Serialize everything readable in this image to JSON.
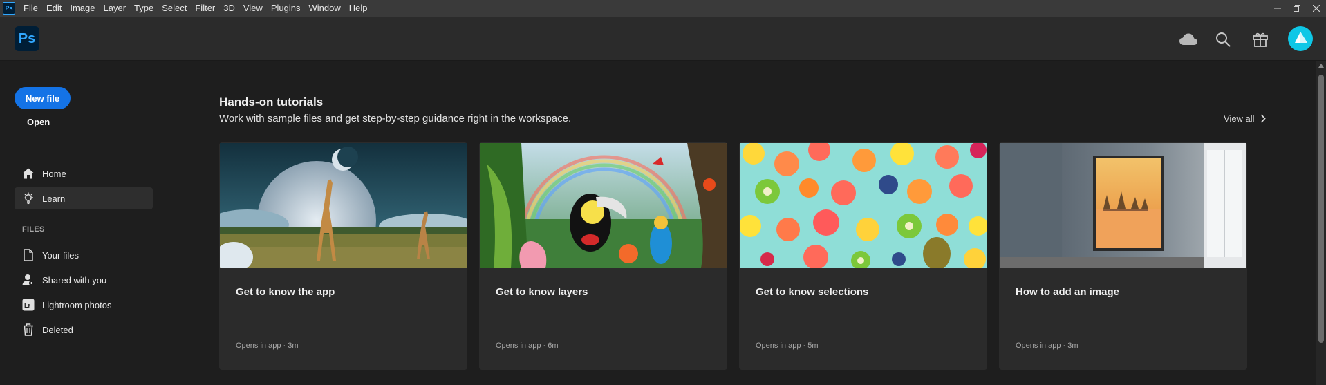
{
  "menubar": {
    "app_badge": "Ps",
    "items": [
      "File",
      "Edit",
      "Image",
      "Layer",
      "Type",
      "Select",
      "Filter",
      "3D",
      "View",
      "Plugins",
      "Window",
      "Help"
    ]
  },
  "header": {
    "logo_text": "Ps",
    "icons": [
      "cloud-icon",
      "search-icon",
      "gift-icon"
    ]
  },
  "sidebar": {
    "new_file_label": "New file",
    "open_label": "Open",
    "nav": [
      {
        "label": "Home",
        "icon": "home-icon"
      },
      {
        "label": "Learn",
        "icon": "lightbulb-icon",
        "active": true
      }
    ],
    "files_heading": "FILES",
    "files": [
      {
        "label": "Your files",
        "icon": "document-icon"
      },
      {
        "label": "Shared with you",
        "icon": "shared-user-icon"
      },
      {
        "label": "Lightroom photos",
        "icon": "lightroom-icon",
        "badge": "Lr"
      },
      {
        "label": "Deleted",
        "icon": "trash-icon"
      }
    ]
  },
  "tutorials": {
    "title": "Hands-on tutorials",
    "subtitle": "Work with sample files and get step-by-step guidance right in the workspace.",
    "view_all": "View all",
    "cards": [
      {
        "title": "Get to know the app",
        "opens": "Opens in app",
        "duration": "3m"
      },
      {
        "title": "Get to know layers",
        "opens": "Opens in app",
        "duration": "6m"
      },
      {
        "title": "Get to know selections",
        "opens": "Opens in app",
        "duration": "5m"
      },
      {
        "title": "How to add an image",
        "opens": "Opens in app",
        "duration": "3m"
      }
    ]
  },
  "colors": {
    "accent": "#1473e6",
    "ps_blue": "#31a8ff",
    "avatar": "#0ec7e6"
  }
}
